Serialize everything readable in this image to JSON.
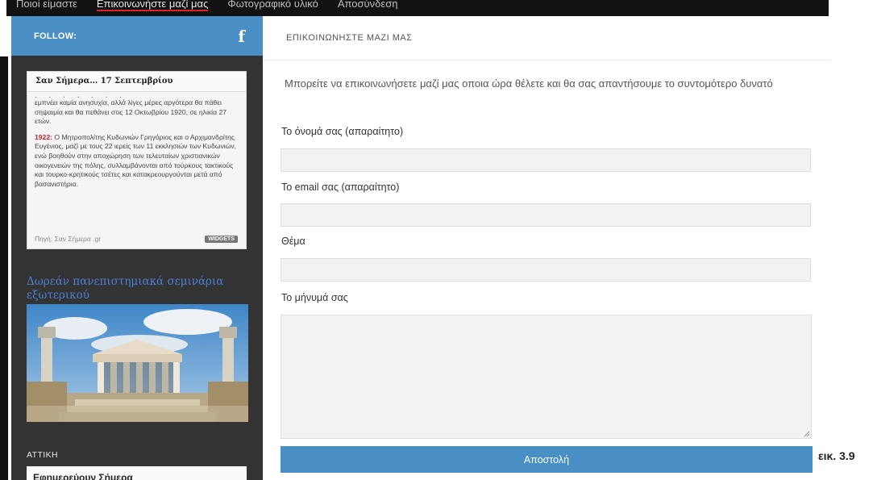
{
  "nav": {
    "items": [
      {
        "label": "Ποιοί είμαστε",
        "active": false
      },
      {
        "label": "Επικοινωνήστε μαζί μας",
        "active": true
      },
      {
        "label": "Φωτογραφικό υλικό",
        "active": false
      },
      {
        "label": "Αποσύνδεση",
        "active": false
      }
    ]
  },
  "sidebar": {
    "follow_label": "FOLLOW:",
    "facebook_icon": "facebook-icon",
    "widget": {
      "title": "Σαν Σήμερα… 17 Σεπτεμβρίου",
      "para1": "εμπνέει καμία ανησυχία, αλλά λίγες μέρες αργότερα θα πάθει σηψαιμία και θα πεθάνει στις 12 Οκτωβρίου 1920, σε ηλικία 27 ετών.",
      "para2_year": "1922:",
      "para2_text": " Ο Μητροπολίτης Κυδωνιών Γρηγόριος και ο Αρχιμανδρίτης Ευγένιος, μαζί με τους 22 ιερείς των 11 εκκλησιών των Κυδωνιών, ενώ βοηθούν στην αποχώρηση των τελευταίων χριστιανικών οικογενειών της πόλης, συλλαμβάνονται από τούρκους τακτικούς και τουρκο-κρητικούς τσέτες και κατακρεουργούνται μετά από βασανιστήρια.",
      "source": "Πηγή: Σαν Σήμερα .gr",
      "badge": "WIDGETS"
    },
    "seminar_link": "Δωρεάν πανεπιστημιακά σεμινάρια εξωτερικού",
    "attiki_label": "ΑΤΤΙΚΗ",
    "duty_title": "Εφημερεύουν Σήμερα"
  },
  "main": {
    "header_title": "ΕΠΙΚΟΙΝΩΝΗΣΤΕ ΜΑΖΙ ΜΑΣ",
    "intro": "Μπορείτε να επικοινωνήσετε μαζί μας οποια ώρα θέλετε και θα σας απαντήσουμε το συντομότερο δυνατό",
    "form": {
      "name_label": "Το όνομά σας (απαραίτητο)",
      "email_label": "Το email σας (απαραίτητο)",
      "subject_label": "Θέμα",
      "message_label": "Το μήνυμά σας",
      "name_value": "",
      "email_value": "",
      "subject_value": "",
      "message_value": "",
      "submit_label": "Αποστολή"
    }
  },
  "caption": "εικ. 3.9",
  "colors": {
    "accent_blue": "#4a8ec6",
    "sidebar_bg": "#333333",
    "active_underline": "#d9232e",
    "link_blue": "#4f7fd6"
  }
}
